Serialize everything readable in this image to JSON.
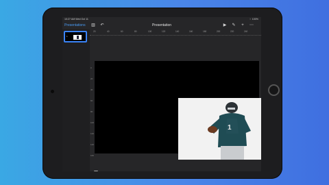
{
  "status": {
    "time": "10:27 AM   Wed Oct 11",
    "right": "⁙ 100%"
  },
  "toolbar": {
    "back_label": "Presentations",
    "title": "Presentation"
  },
  "ruler": {
    "ticks": [
      "20",
      "40",
      "60",
      "80",
      "100",
      "120",
      "140",
      "160",
      "180",
      "200",
      "220",
      "240"
    ]
  },
  "vertical_ruler": {
    "ticks": [
      "0",
      "20",
      "40",
      "60",
      "80",
      "100",
      "120",
      "140",
      "160"
    ]
  },
  "slides": [
    {
      "number": "1",
      "selected": true
    }
  ],
  "icons": {
    "sidebar_toggle": "sidebar-icon",
    "undo": "undo-icon",
    "play": "play-icon",
    "format": "paintbrush-icon",
    "add": "plus-icon",
    "more": "more-icon",
    "add_slide": "add-slide-icon"
  },
  "colors": {
    "accent": "#3a83f7",
    "background": "#3f86e8"
  }
}
